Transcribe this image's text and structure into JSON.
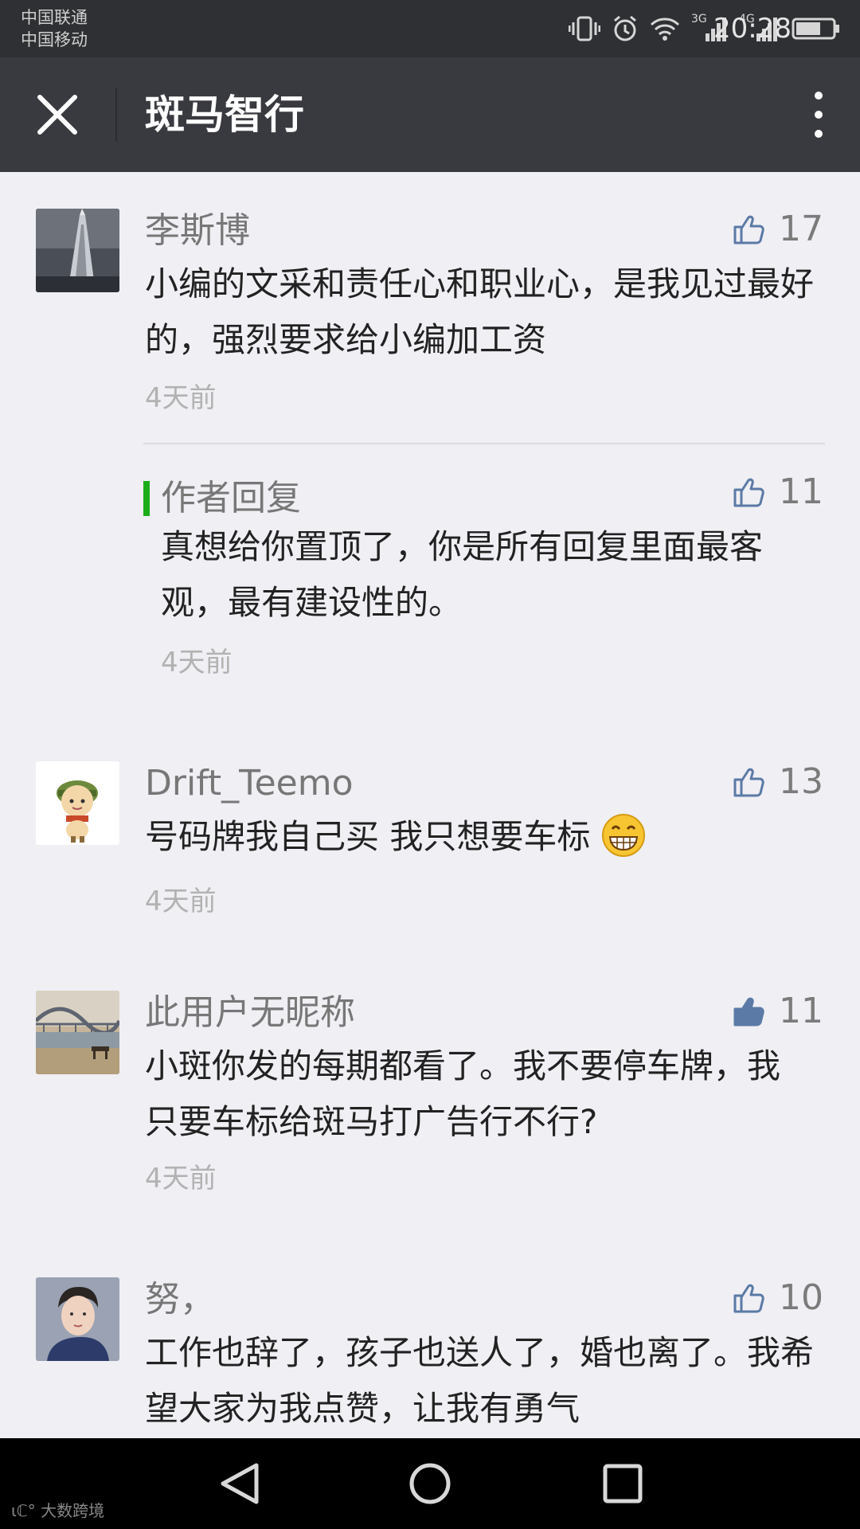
{
  "status_bar": {
    "carrier1": "中国联通",
    "carrier2": "中国移动",
    "net1": "3G",
    "net2": "4G",
    "time": "20:28",
    "icons": [
      "vibrate-icon",
      "alarm-icon",
      "wifi-icon",
      "signal-icon",
      "battery-icon"
    ]
  },
  "header": {
    "title": "斑马智行",
    "close_icon": "close-icon",
    "more_icon": "more-icon"
  },
  "comments": [
    {
      "nickname": "李斯博",
      "likes": "17",
      "liked": false,
      "content": "小编的文采和责任心和职业心，是我见过最好的，强烈要求给小编加工资",
      "time": "4天前",
      "reply": {
        "label": "作者回复",
        "likes": "11",
        "content": "真想给你置顶了，你是所有回复里面最客观，最有建设性的。",
        "time": "4天前"
      }
    },
    {
      "nickname": "Drift_Teemo",
      "likes": "13",
      "liked": false,
      "content": "号码牌我自己买 我只想要车标",
      "emoji": "grinning-emoji",
      "time": "4天前"
    },
    {
      "nickname": "此用户无昵称",
      "likes": "11",
      "liked": true,
      "content": "小斑你发的每期都看了。我不要停车牌，我只要车标给斑马打广告行不行?",
      "time": "4天前"
    },
    {
      "nickname": "努，",
      "likes": "10",
      "liked": false,
      "content": "工作也辞了，孩子也送人了，婚也离了。我希望大家为我点赞，让我有勇气"
    }
  ],
  "nav_bar": {
    "icons": [
      "back-icon",
      "home-icon",
      "recents-icon"
    ],
    "watermark": "大数跨境"
  },
  "colors": {
    "header_bg": "#393a3f",
    "status_bg": "#2f3033",
    "page_bg": "#efeff4",
    "reply_accent": "#1aad19",
    "like_blue": "#5b7aa6"
  }
}
